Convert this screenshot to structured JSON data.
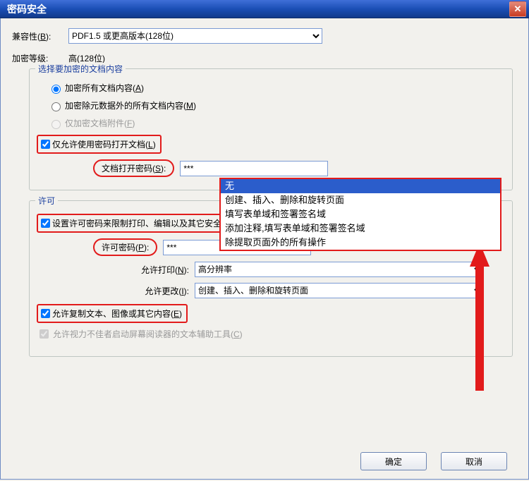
{
  "window": {
    "title": "密码安全",
    "close_symbol": "✕"
  },
  "compat": {
    "label": "兼容性(B):",
    "value": "PDF1.5 或更高版本(128位)"
  },
  "enc_level": {
    "label": "加密等级:",
    "value": "高(128位)"
  },
  "group_content": {
    "legend": "选择要加密的文档内容",
    "opt_all": "加密所有文档内容(A)",
    "opt_except_meta": "加密除元数据外的所有文档内容(M)",
    "opt_attach_only": "仅加密文档附件(F)",
    "chk_open_pw": "仅允许使用密码打开文档(L)",
    "open_pw_label": "文档打开密码(S):",
    "open_pw_value": "***"
  },
  "group_perm": {
    "legend": "许可",
    "chk_restrict": "设置许可密码来限制打印、编辑以及其它安全设置(R)",
    "perm_pw_label": "许可密码(P):",
    "perm_pw_value": "***",
    "print_label": "允许打印(N):",
    "print_value": "高分辨率",
    "change_label": "允许更改(I):",
    "change_value": "创建、插入、删除和旋转页面",
    "chk_copy": "允许复制文本、图像或其它内容(E)",
    "chk_reader": "允许视力不佳者启动屏幕阅读器的文本辅助工具(C)"
  },
  "listbox": {
    "items": [
      "无",
      "创建、插入、删除和旋转页面",
      "填写表单域和签署签名域",
      "添加注释,填写表单域和签署签名域",
      "除提取页面外的所有操作"
    ],
    "selected_index": 0
  },
  "footer": {
    "ok": "确定",
    "cancel": "取消"
  }
}
